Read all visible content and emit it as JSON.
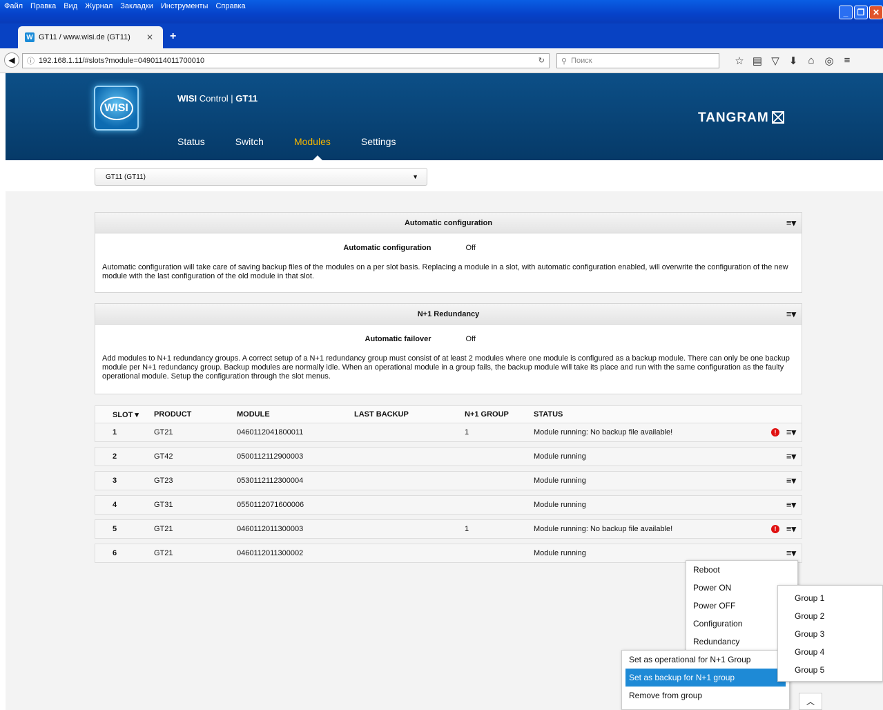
{
  "browser": {
    "menu": [
      "Файл",
      "Правка",
      "Вид",
      "Журнал",
      "Закладки",
      "Инструменты",
      "Справка"
    ],
    "tab_title": "GT11 / www.wisi.de (GT11)",
    "url": "192.168.1.11/#slots?module=0490114011700010",
    "search_placeholder": "Поиск"
  },
  "app": {
    "brand": "WISI",
    "title_mid": " Control | ",
    "title_device": "GT11",
    "logo_text": "WISI",
    "tangram": "TANGRAM",
    "nav": [
      "Status",
      "Switch",
      "Modules",
      "Settings"
    ],
    "active_nav": "Modules",
    "module_select": "GT11 (GT11)"
  },
  "auto_config": {
    "title": "Automatic configuration",
    "key": "Automatic configuration",
    "value": "Off",
    "description": "Automatic configuration will take care of saving backup files of the modules on a per slot basis. Replacing a module in a slot, with automatic configuration enabled, will overwrite the configuration of the new module with the last configuration of the old module in that slot."
  },
  "redundancy": {
    "title": "N+1 Redundancy",
    "key": "Automatic failover",
    "value": "Off",
    "description": "Add modules to N+1 redundancy groups. A correct setup of a N+1 redundancy group must consist of at least 2 modules where one module is configured as a backup module. There can only be one backup module per N+1 redundancy group. Backup modules are normally idle. When an operational module in a group fails, the backup module will take its place and run with the same configuration as the faulty operational module. Setup the configuration through the slot menus."
  },
  "table": {
    "headers": [
      "SLOT ▾",
      "PRODUCT",
      "MODULE",
      "LAST BACKUP",
      "N+1 GROUP",
      "STATUS"
    ],
    "rows": [
      {
        "slot": "1",
        "product": "GT21",
        "module": "0460112041800011",
        "backup": "",
        "group": "1",
        "status": "Module running: No backup file available!",
        "warn": true
      },
      {
        "slot": "2",
        "product": "GT42",
        "module": "0500112112900003",
        "backup": "",
        "group": "",
        "status": "Module running",
        "warn": false
      },
      {
        "slot": "3",
        "product": "GT23",
        "module": "0530112112300004",
        "backup": "",
        "group": "",
        "status": "Module running",
        "warn": false
      },
      {
        "slot": "4",
        "product": "GT31",
        "module": "0550112071600006",
        "backup": "",
        "group": "",
        "status": "Module running",
        "warn": false
      },
      {
        "slot": "5",
        "product": "GT21",
        "module": "0460112011300003",
        "backup": "",
        "group": "1",
        "status": "Module running: No backup file available!",
        "warn": true
      },
      {
        "slot": "6",
        "product": "GT21",
        "module": "0460112011300002",
        "backup": "",
        "group": "",
        "status": "Module running",
        "warn": false
      }
    ]
  },
  "slot_menu": [
    "Reboot",
    "Power ON",
    "Power OFF",
    "Configuration",
    "Redundancy"
  ],
  "redundancy_menu": [
    "Set as operational for N+1 Group",
    "Set as backup for N+1 group",
    "Remove from group"
  ],
  "redundancy_menu_selected": "Set as backup for N+1 group",
  "group_menu": [
    "Group 1",
    "Group 2",
    "Group 3",
    "Group 4",
    "Group 5"
  ]
}
